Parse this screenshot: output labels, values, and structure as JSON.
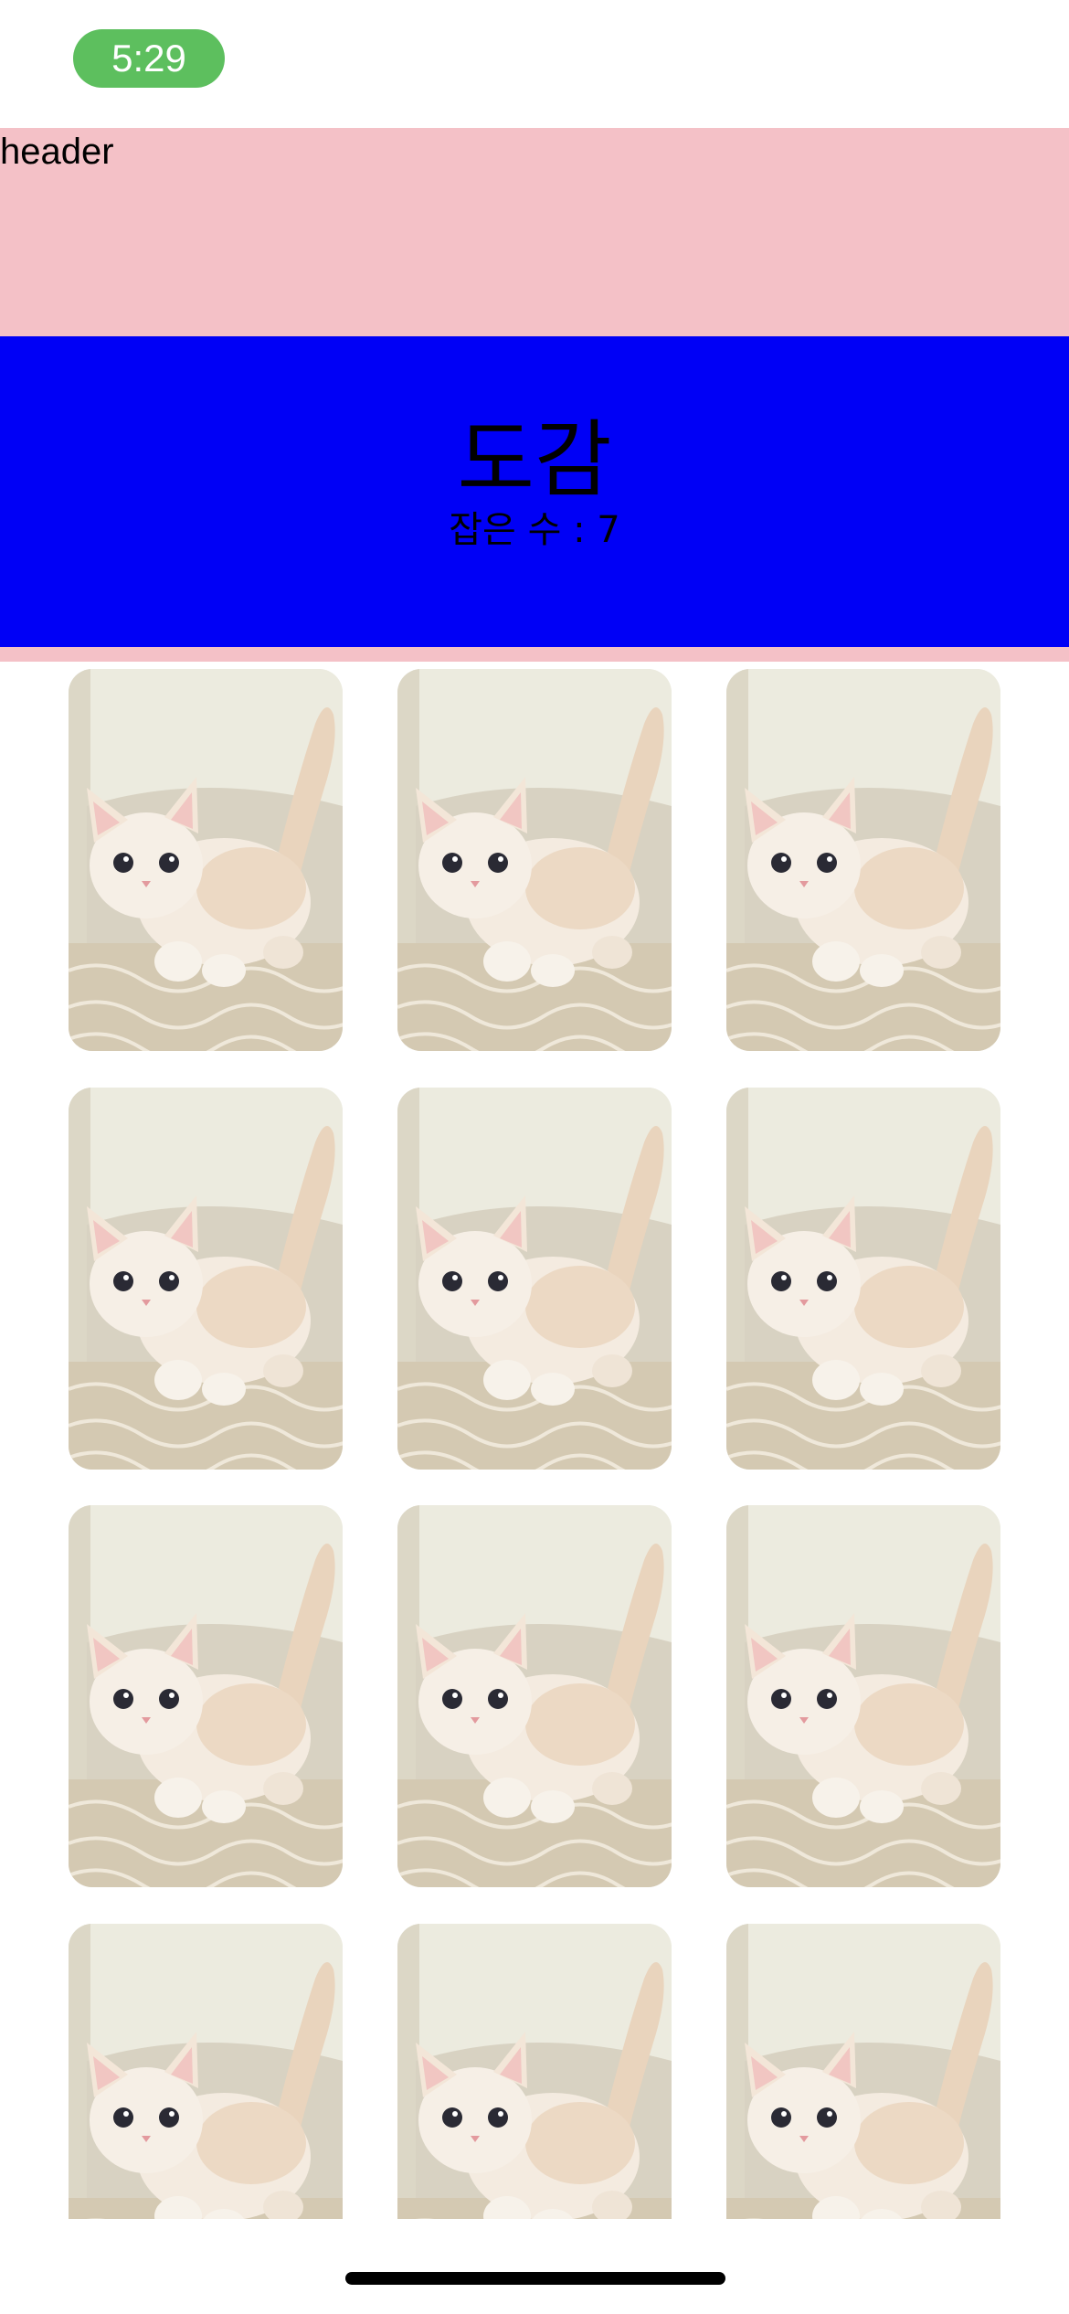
{
  "status_bar": {
    "time": "5:29"
  },
  "header": {
    "label": "header"
  },
  "banner": {
    "title": "도감",
    "count_text": "잡은 수 : 7"
  },
  "grid": {
    "cards": [
      {
        "image": "white-kitten-photo"
      },
      {
        "image": "white-kitten-photo"
      },
      {
        "image": "white-kitten-photo"
      },
      {
        "image": "white-kitten-photo"
      },
      {
        "image": "white-kitten-photo"
      },
      {
        "image": "white-kitten-photo"
      },
      {
        "image": "white-kitten-photo"
      },
      {
        "image": "white-kitten-photo"
      },
      {
        "image": "white-kitten-photo"
      },
      {
        "image": "white-kitten-photo"
      },
      {
        "image": "white-kitten-photo"
      },
      {
        "image": "white-kitten-photo"
      }
    ]
  },
  "colors": {
    "header_bg": "#f4c1c7",
    "banner_bg": "#0000f6",
    "time_pill": "#5dbf5e"
  }
}
